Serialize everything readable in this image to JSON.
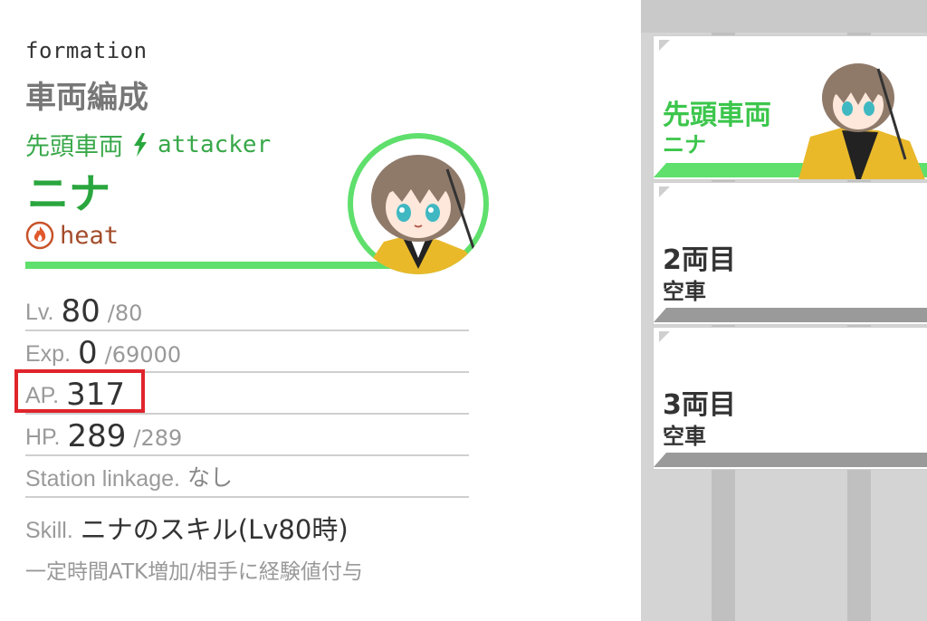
{
  "header": {
    "formation_en": "formation",
    "formation_ja": "車両編成"
  },
  "lead": {
    "position": "先頭車両",
    "role": "attacker",
    "name": "ニナ",
    "element": "heat",
    "element_icon": "fire-icon",
    "role_icon": "lightning-icon"
  },
  "stats": [
    {
      "label": "Lv.",
      "value": "80",
      "max": "/80"
    },
    {
      "label": "Exp.",
      "value": "0",
      "max": "/69000"
    },
    {
      "label": "AP.",
      "value": "317",
      "max": ""
    },
    {
      "label": "HP.",
      "value": "289",
      "max": "/289"
    },
    {
      "label": "Station linkage.",
      "value": "なし",
      "max": ""
    }
  ],
  "skill": {
    "label": "Skill.",
    "name": "ニナのスキル(Lv80時)",
    "description": "一定時間ATK増加/相手に経験値付与"
  },
  "cars": [
    {
      "title": "先頭車両",
      "subtitle": "ニナ"
    },
    {
      "title": "2両目",
      "subtitle": "空車"
    },
    {
      "title": "3両目",
      "subtitle": "空車"
    }
  ],
  "colors": {
    "accent_green": "#5fdf6c",
    "text_green": "#2aa63e",
    "highlight_red": "#e0242c",
    "heat": "#a34c2a"
  }
}
